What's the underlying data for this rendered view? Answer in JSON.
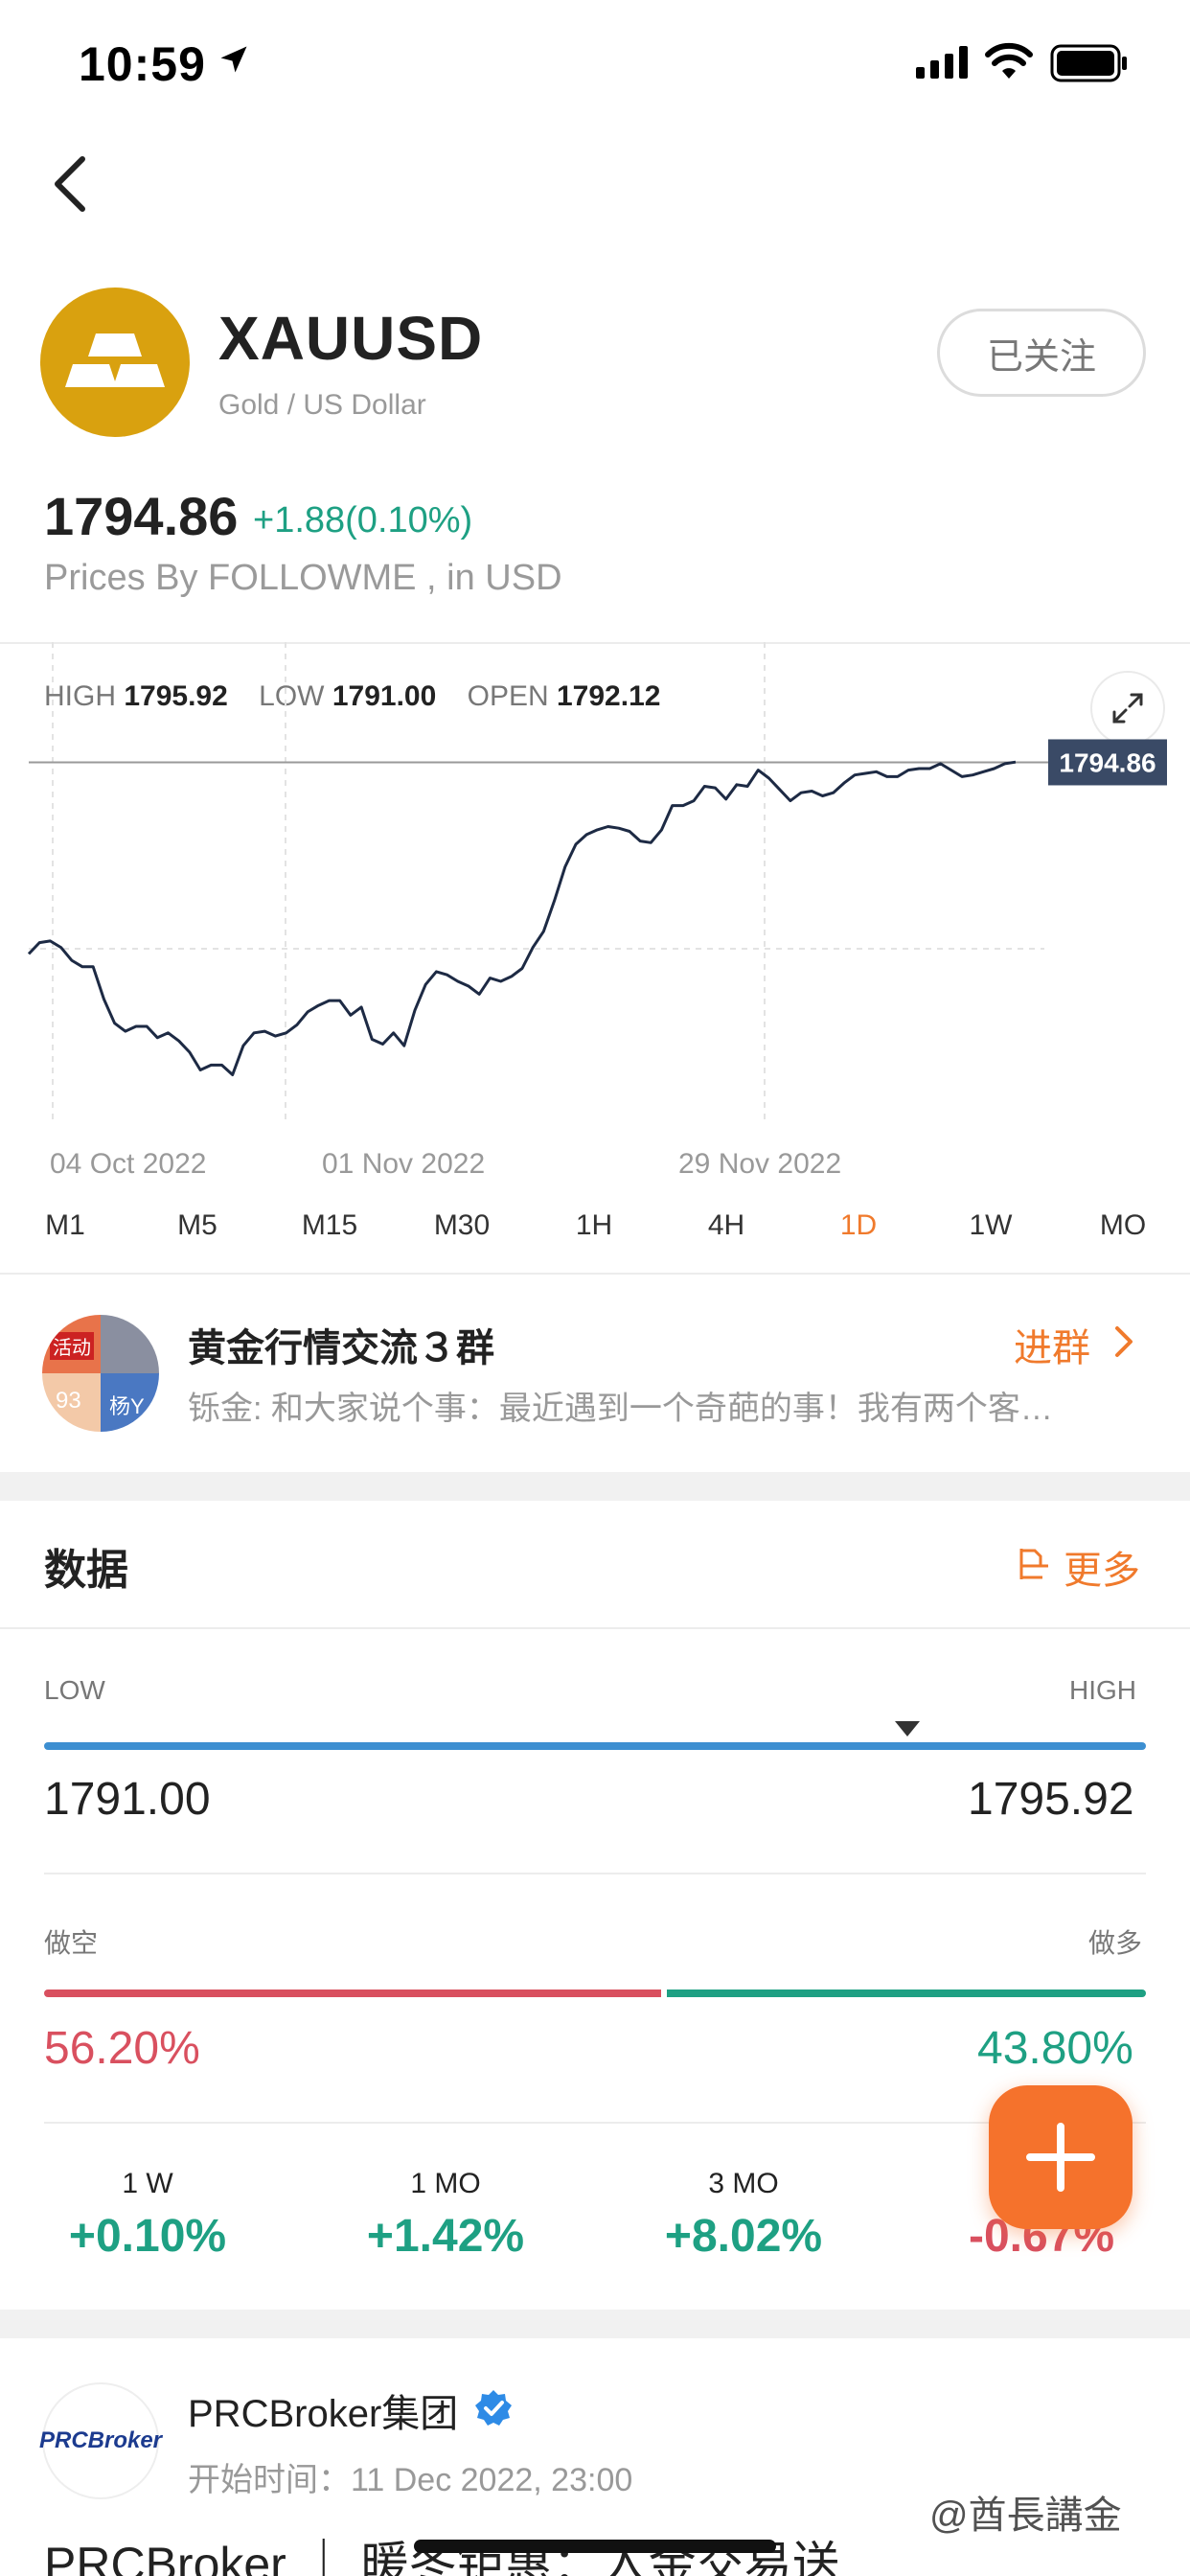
{
  "status_bar": {
    "time": "10:59"
  },
  "header": {
    "ticker": "XAUUSD",
    "subtitle": "Gold / US Dollar",
    "follow_label": "已关注",
    "price": "1794.86",
    "change": "+1.88(0.10%)",
    "price_note": "Prices By FOLLOWME , in USD"
  },
  "chart_stats": {
    "high_label": "HIGH",
    "high_value": "1795.92",
    "low_label": "LOW",
    "low_value": "1791.00",
    "open_label": "OPEN",
    "open_value": "1792.12"
  },
  "chart_data": {
    "type": "line",
    "x_tick_labels": [
      "04 Oct 2022",
      "01 Nov 2022",
      "29 Nov 2022"
    ],
    "current_price_label": "1794.86",
    "y": [
      1676,
      1683,
      1684,
      1680,
      1672,
      1668,
      1668,
      1648,
      1633,
      1628,
      1631,
      1631,
      1624,
      1627,
      1622,
      1615,
      1604,
      1607,
      1607,
      1601,
      1619,
      1627,
      1628,
      1625,
      1627,
      1632,
      1640,
      1644,
      1647,
      1647,
      1638,
      1643,
      1623,
      1620,
      1627,
      1619,
      1641,
      1657,
      1665,
      1663,
      1659,
      1656,
      1651,
      1661,
      1659,
      1662,
      1667,
      1680,
      1690,
      1709,
      1730,
      1744,
      1750,
      1753,
      1755,
      1754,
      1752,
      1746,
      1745,
      1753,
      1768,
      1768,
      1771,
      1780,
      1779,
      1772,
      1781,
      1780,
      1790,
      1785,
      1778,
      1771,
      1776,
      1777,
      1774,
      1776,
      1782,
      1787,
      1788,
      1789,
      1786,
      1786,
      1790,
      1791,
      1791,
      1794,
      1790,
      1786,
      1787,
      1789,
      1791,
      1794,
      1795
    ],
    "reference_line": 1794.86
  },
  "timeframes": {
    "items": [
      "M1",
      "M5",
      "M15",
      "M30",
      "1H",
      "4H",
      "1D",
      "1W",
      "MO"
    ],
    "active": "1D"
  },
  "group": {
    "title": "黄金行情交流３群",
    "message": "铄金: 和大家说个事：最近遇到一个奇葩的事！我有两个客…",
    "join_label": "进群",
    "avatar_tag": "活动",
    "avatar_num": "93",
    "avatar_name": "杨Y"
  },
  "data_section": {
    "title": "数据",
    "more_label": "更多",
    "range": {
      "low_label": "LOW",
      "high_label": "HIGH",
      "low_value": "1791.00",
      "high_value": "1795.92",
      "marker_position": 0.786
    },
    "sentiment": {
      "short_label": "做空",
      "long_label": "做多",
      "short_value": "56.20%",
      "long_value": "43.80%",
      "short_fraction": 0.562
    },
    "performance": [
      {
        "label": "1 W",
        "value": "+0.10%"
      },
      {
        "label": "1 MO",
        "value": "+1.42%"
      },
      {
        "label": "3 MO",
        "value": "+8.02%"
      },
      {
        "label": "",
        "value": "-0.67%"
      }
    ]
  },
  "post": {
    "author": "PRCBroker集团",
    "avatar_text": "PRCBroker",
    "time": "开始时间：11 Dec 2022, 23:00",
    "title": "PRCBroker ｜ 暖冬钜惠：入金交易送",
    "watermark": "@酋長講金"
  },
  "colors": {
    "accent": "#f07a2c",
    "up": "#1ea083",
    "down": "#d9505f",
    "gold": "#d9a10f",
    "range_bar": "#3d8fd1"
  }
}
